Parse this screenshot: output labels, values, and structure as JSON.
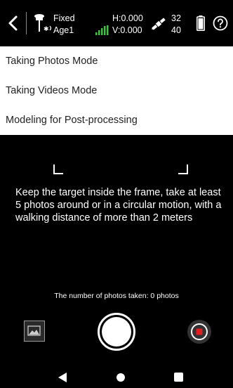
{
  "status": {
    "fix_type": "Fixed",
    "base_name": "Age1",
    "h_precision": "H:0.000",
    "v_precision": "V:0.000",
    "sats_top": "32",
    "sats_bottom": "40",
    "signal_color": "#3ec43e"
  },
  "menu": {
    "items": [
      {
        "label": "Taking Photos Mode"
      },
      {
        "label": "Taking Videos Mode"
      },
      {
        "label": "Modeling for Post-processing"
      }
    ]
  },
  "camera": {
    "instructions": "Keep the target inside the frame, take at least 5 photos around or in a circular motion, with a walking distance of more than 2 meters",
    "photo_count_text": "The number of photos taken: 0 photos",
    "record_color": "#e02020"
  }
}
